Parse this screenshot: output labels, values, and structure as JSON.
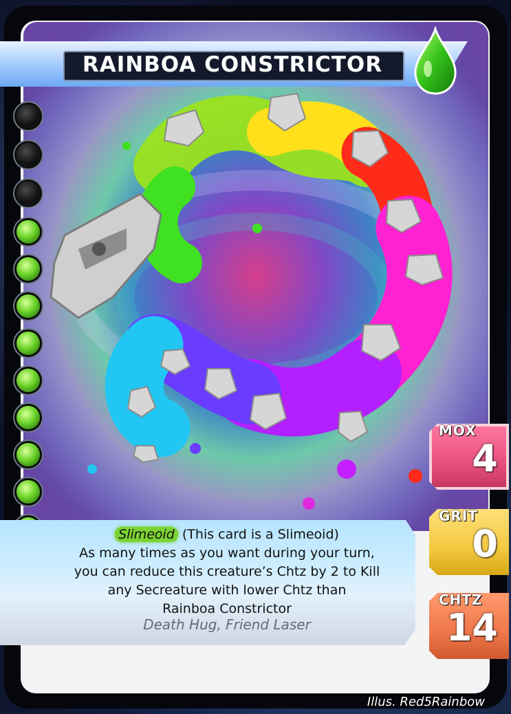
{
  "card": {
    "name": "Rainboa Constrictor",
    "keyword": "Slimeoid",
    "keyword_note": "(This card is a Slimeoid)",
    "rules_lines": [
      "As many times as you want during your turn,",
      "you can reduce this creature’s Chtz by 2 to Kill",
      "any Secreature with lower Chtz than",
      "Rainboa Constrictor"
    ],
    "flavor": "Death Hug, Friend Laser",
    "illustrator": "Illus. Red5Rainbow",
    "element_icon": "green-drop-icon",
    "pips": {
      "dark": 3,
      "green": 9
    }
  },
  "stats": {
    "mox": {
      "label": "MOX",
      "value": "4",
      "color": "#e8507c"
    },
    "grit": {
      "label": "GRIT",
      "value": "0",
      "color": "#f3c940"
    },
    "chtz": {
      "label": "CHTZ",
      "value": "14",
      "color": "#f0774a"
    }
  },
  "colors": {
    "title_bg": "#141a2c",
    "text_box": "#cfeeff",
    "keyword_highlight": "#7bd331"
  }
}
